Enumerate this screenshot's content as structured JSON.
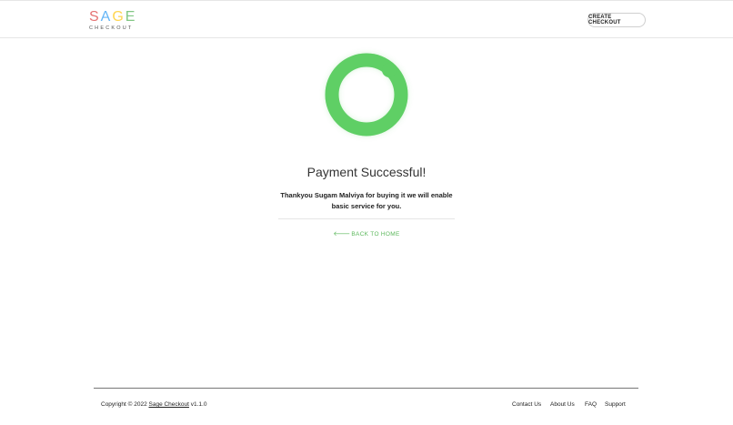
{
  "header": {
    "logo": {
      "letters": [
        "S",
        "A",
        "G",
        "E"
      ],
      "letter_colors": [
        "#e57373",
        "#64b5f6",
        "#ffd54f",
        "#81c784"
      ],
      "subtitle": "CHECKOUT"
    },
    "create_checkout_label": "CREATE CHECKOUT"
  },
  "main": {
    "success_icon": "success-ring-icon",
    "accent_color": "#5fcf65",
    "title": "Payment Successful!",
    "message": "Thankyou Sugam Malviya for buying it we will enable basic service for you.",
    "back_arrow_icon": "arrow-left-icon",
    "back_label": "BACK TO HOME"
  },
  "footer": {
    "copyright_prefix": "Copyright © 2022 ",
    "brand_link": "Sage Checkout",
    "version": " v1.1.0",
    "links": [
      "Contact Us",
      "About Us",
      "FAQ",
      "Support"
    ]
  }
}
